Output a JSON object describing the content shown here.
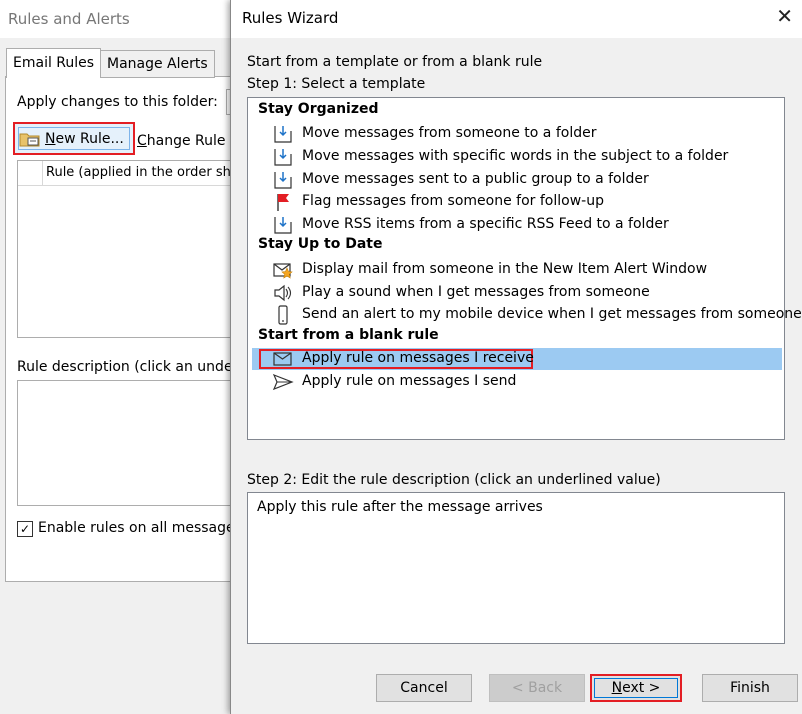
{
  "background_window": {
    "title": "Rules and Alerts",
    "tabs": [
      {
        "label": "Email Rules",
        "active": true
      },
      {
        "label": "Manage Alerts",
        "active": false
      }
    ],
    "apply_changes_label": "Apply changes to this folder:",
    "new_rule_prefix": "N",
    "new_rule_rest": "ew Rule...",
    "change_rule_prefix": "C",
    "change_rule_rest": "hange Rule ▾",
    "rule_column_header": "Rule (applied in the order sho",
    "rule_description_label": "Rule description (click an under",
    "enable_rules_label": "Enable rules on all messages",
    "enable_rules_checked": true
  },
  "wizard": {
    "title": "Rules Wizard",
    "intro": "Start from a template or from a blank rule",
    "step1": "Step 1: Select a template",
    "groups": [
      {
        "header": "Stay Organized",
        "items": [
          {
            "label": "Move messages from someone to a folder",
            "icon": "move-to-folder-icon"
          },
          {
            "label": "Move messages with specific words in the subject to a folder",
            "icon": "move-to-folder-icon"
          },
          {
            "label": "Move messages sent to a public group to a folder",
            "icon": "move-to-folder-icon"
          },
          {
            "label": "Flag messages from someone for follow-up",
            "icon": "flag-icon"
          },
          {
            "label": "Move RSS items from a specific RSS Feed to a folder",
            "icon": "move-to-folder-icon"
          }
        ]
      },
      {
        "header": "Stay Up to Date",
        "items": [
          {
            "label": "Display mail from someone in the New Item Alert Window",
            "icon": "alert-window-icon"
          },
          {
            "label": "Play a sound when I get messages from someone",
            "icon": "speaker-icon"
          },
          {
            "label": "Send an alert to my mobile device when I get messages from someone",
            "icon": "mobile-icon"
          }
        ]
      },
      {
        "header": "Start from a blank rule",
        "items": [
          {
            "label": "Apply rule on messages I receive",
            "icon": "envelope-icon",
            "selected": true
          },
          {
            "label": "Apply rule on messages I send",
            "icon": "send-icon"
          }
        ]
      }
    ],
    "step2": "Step 2: Edit the rule description (click an underlined value)",
    "rule_description": "Apply this rule after the message arrives",
    "buttons": {
      "cancel": "Cancel",
      "back": "< Back",
      "next_prefix": "N",
      "next_rest": "ext >",
      "finish": "Finish"
    }
  },
  "colors": {
    "highlight_red": "#e31e24",
    "selection_blue": "#9ccaf2",
    "focus_blue": "#0078d7"
  }
}
